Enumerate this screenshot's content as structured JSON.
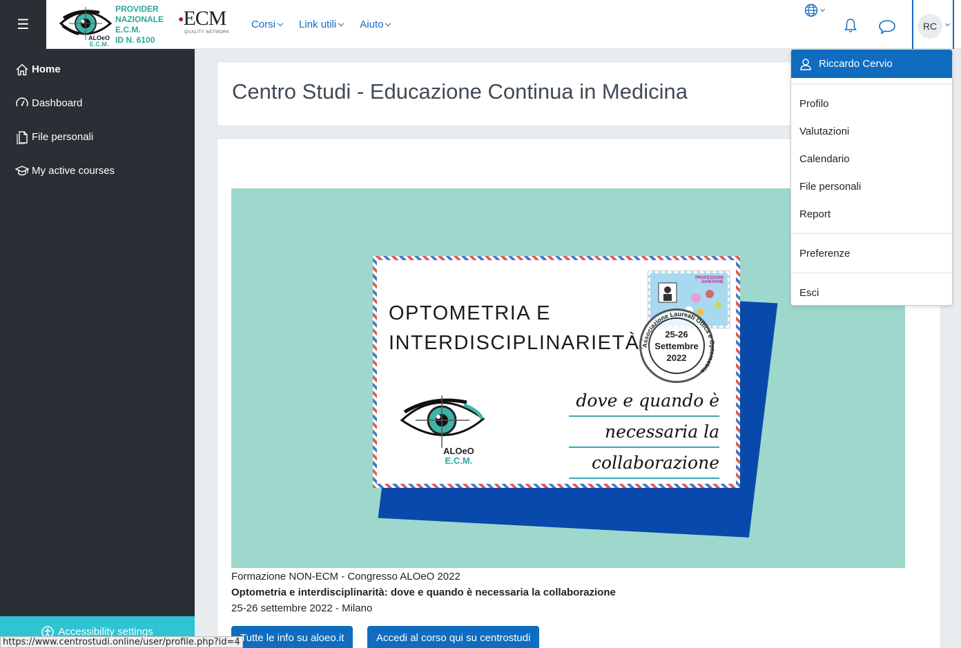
{
  "header": {
    "menu_icon": "hamburger-icon",
    "provider_lines": [
      "PROVIDER",
      "NAZIONALE",
      "E.C.M.",
      "ID N. 6100"
    ],
    "logo_small_1": "ALOeO",
    "logo_small_2": "E.C.M.",
    "ecm_big": "ECM",
    "ecm_small": "QUALITY NETWORK",
    "nav": [
      {
        "label": "Corsi"
      },
      {
        "label": "Link utili"
      },
      {
        "label": "Aiuto"
      }
    ],
    "user_initials": "RC"
  },
  "sidebar": {
    "items": [
      {
        "label": "Home",
        "icon": "home-icon"
      },
      {
        "label": "Dashboard",
        "icon": "dashboard-icon"
      },
      {
        "label": "File personali",
        "icon": "file-icon"
      },
      {
        "label": "My active courses",
        "icon": "graduation-cap-icon"
      }
    ],
    "accessibility_label": "Accessibility settings"
  },
  "main": {
    "title": "Centro Studi - Educazione Continua in Medicina",
    "banner": {
      "title_line1": "OPTOMETRIA E",
      "title_line2": "INTERDISCIPLINARIETÀ:",
      "sub1": "dove e quando è",
      "sub2": "necessaria la",
      "sub3": "collaborazione",
      "stamp_label_1": "PROFESSIONI",
      "stamp_label_2": "SANITARIE",
      "postmark_1": "25-26",
      "postmark_2": "Settembre",
      "postmark_3": "2022",
      "postmark_ring": "Associazione Laureati Ottica e Optometria",
      "logo_1": "ALOeO",
      "logo_2": "E.C.M."
    },
    "caption_1": "Formazione NON-ECM - Congresso ALOeO 2022",
    "caption_2": "Optometria e interdisciplinarità: dove e quando è necessaria la collaborazione",
    "caption_3": "25-26 settembre 2022 - Milano",
    "button_1": "Tutte le info su aloeo.it",
    "button_2": "Accedi al corso qui su centrostudi"
  },
  "user_menu": {
    "name": "Riccardo Cervio",
    "group1": [
      "Profilo",
      "Valutazioni",
      "Calendario",
      "File personali",
      "Report"
    ],
    "group2": [
      "Preferenze"
    ],
    "group3": [
      "Esci"
    ]
  },
  "status_url": "https://www.centrostudi.online/user/profile.php?id=4",
  "colors": {
    "accent": "#0f6cbf",
    "sidebar": "#2a2f35",
    "accessibility": "#2ec4d4",
    "banner_bg": "#9ed8cc"
  }
}
